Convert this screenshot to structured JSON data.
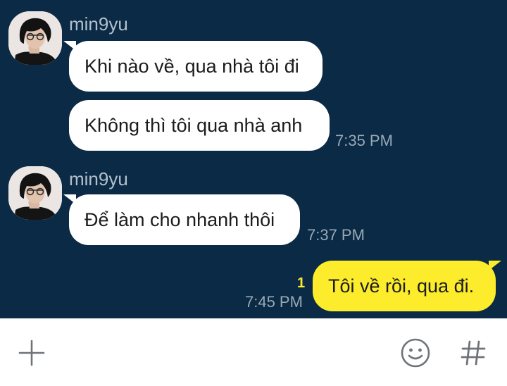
{
  "chat": {
    "messages": [
      {
        "sender": "min9yu",
        "text": "Khi nào về, qua nhà tôi đi",
        "time": ""
      },
      {
        "sender": "",
        "text": "Không thì tôi qua nhà anh",
        "time": "7:35 PM"
      },
      {
        "sender": "min9yu",
        "text": "Để làm cho nhanh thôi",
        "time": "7:37 PM"
      }
    ],
    "outgoing": {
      "text": "Tôi về rồi, qua đi.",
      "time": "7:45 PM",
      "unread_count": "1"
    }
  },
  "composer": {
    "add_icon": "plus-icon",
    "emoji_icon": "emoji-icon",
    "hashtag_icon": "hashtag-icon"
  },
  "colors": {
    "background": "#0b2a45",
    "incoming_bubble": "#ffffff",
    "outgoing_bubble": "#fcec2c",
    "unread": "#fcec2c"
  }
}
